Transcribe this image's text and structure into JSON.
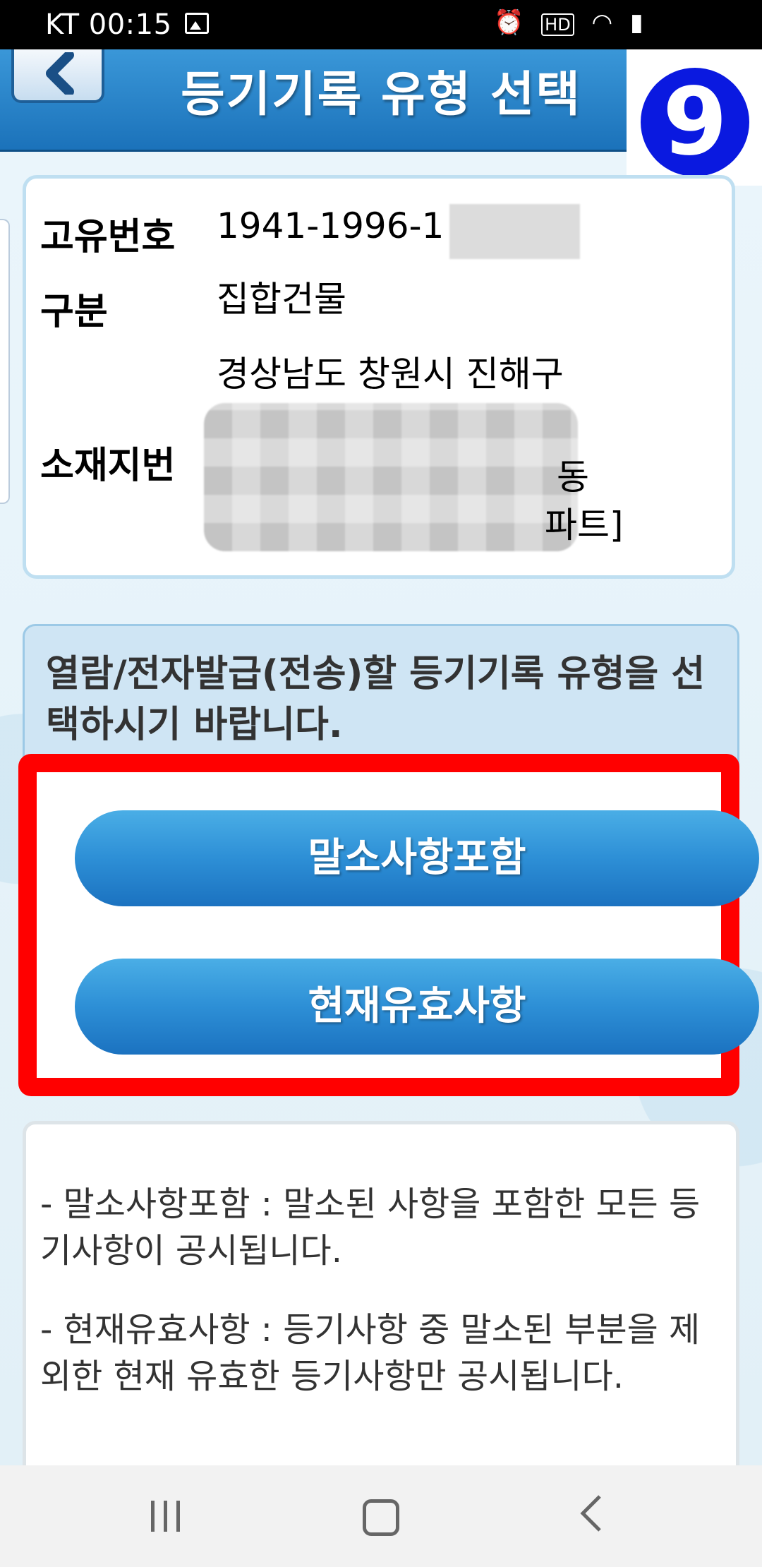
{
  "status_bar": {
    "carrier_time": "KT 00:15",
    "right_icons": [
      "alarm-icon",
      "hd-icon",
      "wifi-icon",
      "signal-icon"
    ]
  },
  "header": {
    "title": "등기기록 유형 선택",
    "step_number": "9"
  },
  "info": {
    "unique_number_label": "고유번호",
    "unique_number_value": "1941-1996-1",
    "category_label": "구분",
    "category_value": "집합건물",
    "address_label": "소재지번",
    "address_line1": "경상남도 창원시 진해구",
    "address_frag1": "동",
    "address_frag2": "파트]"
  },
  "choice": {
    "prompt": "열람/전자발급(전송)할 등기기록 유형을 선택하시기 바랍니다.",
    "options": [
      "말소사항포함",
      "현재유효사항"
    ]
  },
  "description": {
    "items": [
      "- 말소사항포함 : 말소된 사항을 포함한 모든 등기사항이 공시됩니다.",
      "- 현재유효사항 : 등기사항 중 말소된 부분을 제외한 현재 유효한 등기사항만 공시됩니다."
    ]
  },
  "colors": {
    "header_blue": "#1b72ba",
    "button_blue": "#2d8fd6",
    "highlight_red": "#ff0000",
    "badge_blue": "#0a19e0"
  }
}
